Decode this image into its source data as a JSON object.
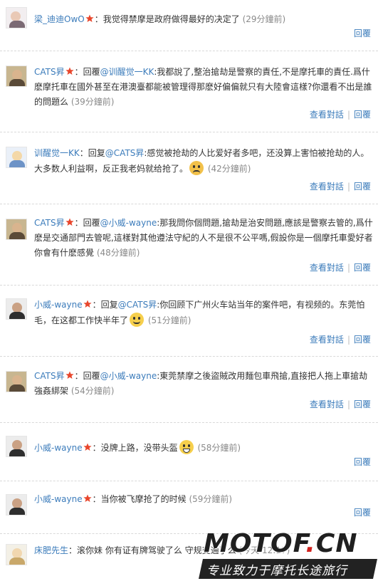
{
  "colors": {
    "link": "#3c7cbb",
    "time": "#8a8a8a",
    "separator": "#bbbbbb",
    "watermark_accent": "#d1211c"
  },
  "actions": {
    "view_conversation": "查看對話",
    "reply": "回覆"
  },
  "comments": [
    {
      "user": "梁_迪迪OwO",
      "verified": true,
      "sep": "：",
      "text": "我觉得禁摩是政府做得最好的决定了",
      "time": "(29分鐘前)",
      "show_conversation": false
    },
    {
      "user": "CATS昇",
      "verified": true,
      "sep": "：",
      "prefix": "回覆",
      "mention": "@训醒觉一KK",
      "text": ":我都說了,整治搶劫是警察的責任,不是摩托車的責任.爲什麽摩托車在國外甚至在港澳臺都能被管理得那麽好偏偏就只有大陸會這樣?你還看不出是誰的問題么",
      "time": "(39分鐘前)",
      "show_conversation": true
    },
    {
      "user": "训醒觉一KK",
      "verified": false,
      "sep": "：",
      "prefix": "回复",
      "mention": "@CATS昇",
      "text": ":感觉被抢劫的人比爱好者多吧，还没算上害怕被抢劫的人。大多数人利益啊，反正我老妈就给抢了。",
      "emoticon": "angry-face-emoticon",
      "time": "(42分鐘前)",
      "show_conversation": true
    },
    {
      "user": "CATS昇",
      "verified": true,
      "sep": "：",
      "prefix": "回覆",
      "mention": "@小威-wayne",
      "text": ":那我問你個問題,搶劫是治安問題,應該是警察去管的,爲什麽是交通部門去管呢,這樣對其他遵法守紀的人不是很不公平嗎,假設你是一個摩托車愛好者你會有什麽感覺",
      "time": "(48分鐘前)",
      "show_conversation": true
    },
    {
      "user": "小威-wayne",
      "verified": true,
      "sep": "：",
      "prefix": "回复",
      "mention": "@CATS昇",
      "text": ":你回顾下广州火车站当年的案件吧，有视频的。东莞怕毛，在这都工作快半年了",
      "emoticon": "smile-emoticon",
      "time": "(51分鐘前)",
      "show_conversation": true
    },
    {
      "user": "CATS昇",
      "verified": true,
      "sep": "：",
      "prefix": "回覆",
      "mention": "@小威-wayne",
      "text": ":東莞禁摩之後盜賊改用麵包車飛搶,直接把人拖上車搶劫強姦綁架",
      "time": "(54分鐘前)",
      "show_conversation": true
    },
    {
      "user": "小威-wayne",
      "verified": true,
      "sep": "：",
      "text": "没牌上路，没带头盔",
      "emoticon": "grin-emoticon",
      "time": "(58分鐘前)",
      "show_conversation": false
    },
    {
      "user": "小威-wayne",
      "verified": true,
      "sep": "：",
      "text": "当你被飞摩抢了的时候",
      "time": "(59分鐘前)",
      "show_conversation": false
    },
    {
      "user": "床肥先生",
      "verified": false,
      "sep": "：",
      "text": "滚你妹 你有证有牌驾驶了么 守规交通了么",
      "time": "(今天 12:17)",
      "show_conversation": false
    }
  ],
  "watermark": {
    "site": "MOTOF",
    "dot": ".",
    "tld": "CN",
    "slogan": "专业致力于摩托长途旅行"
  }
}
